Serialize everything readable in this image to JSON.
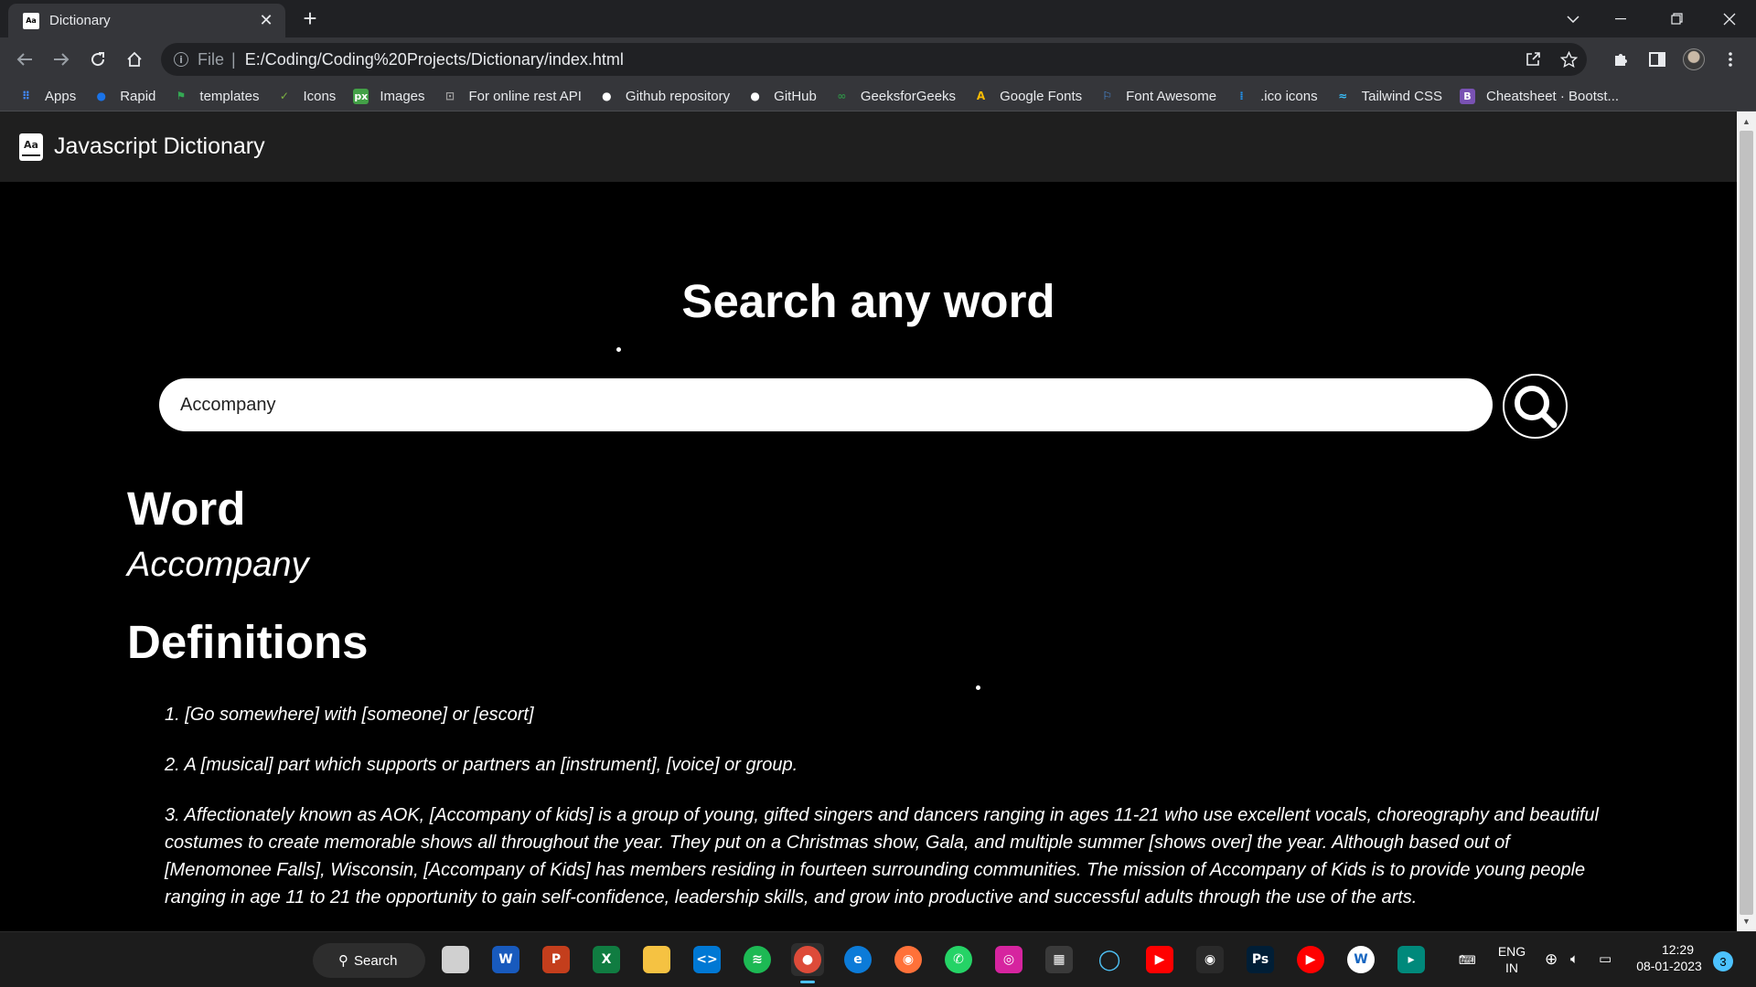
{
  "browser": {
    "tab_title": "Dictionary",
    "tab_favicon_text": "Aa",
    "url_scheme_label": "File",
    "url": "E:/Coding/Coding%20Projects/Dictionary/index.html"
  },
  "bookmarks": [
    {
      "label": "Apps",
      "icon": "apps-grid-icon",
      "color": "#4285f4"
    },
    {
      "label": "Rapid",
      "icon": "rapid-icon",
      "color": "#1a73e8"
    },
    {
      "label": "templates",
      "icon": "templates-flag-icon",
      "color": "#34a853"
    },
    {
      "label": "Icons",
      "icon": "icons-check-icon",
      "color": "#7cb342"
    },
    {
      "label": "Images",
      "icon": "px-icon",
      "color": "#43a047"
    },
    {
      "label": "For online rest API",
      "icon": "rest-api-icon",
      "color": "#9e9e9e"
    },
    {
      "label": "Github repository",
      "icon": "github-icon",
      "color": "#ffffff"
    },
    {
      "label": "GitHub",
      "icon": "github-icon",
      "color": "#ffffff"
    },
    {
      "label": "GeeksforGeeks",
      "icon": "gfg-icon",
      "color": "#2f8d46"
    },
    {
      "label": "Google Fonts",
      "icon": "google-fonts-icon",
      "color": "#fbbc04"
    },
    {
      "label": "Font Awesome",
      "icon": "font-awesome-flag-icon",
      "color": "#4a90e2"
    },
    {
      "label": ".ico icons",
      "icon": "ico-icons-icon",
      "color": "#2196f3"
    },
    {
      "label": "Tailwind CSS",
      "icon": "tailwind-icon",
      "color": "#38bdf8"
    },
    {
      "label": "Cheatsheet · Bootst...",
      "icon": "bootstrap-icon",
      "color": "#7952b3"
    }
  ],
  "app": {
    "brand_icon_text": "Aa",
    "brand": "Javascript Dictionary",
    "heading": "Search any word",
    "search_value": "Accompany",
    "word_label": "Word",
    "word": "Accompany",
    "definitions_label": "Definitions",
    "definitions": [
      "1. [Go somewhere] with [someone] or [escort]",
      "2. A [musical] part which supports or partners an [instrument], [voice] or group.",
      "3. Affectionately known as AOK, [Accompany of kids] is a group of young, gifted singers and dancers ranging in ages 11-21 who use excellent vocals, choreography and beautiful costumes to create memorable shows all throughout the year. They put on a Christmas show, Gala, and multiple summer [shows over] the year. Although based out of [Menomonee Falls], Wisconsin, [Accompany of Kids] has members residing in fourteen surrounding communities. The mission of Accompany of Kids is to provide young people ranging in age 11 to 21 the opportunity to gain self-confidence, leadership skills, and grow into productive and successful adults through the use of the arts."
    ]
  },
  "taskbar": {
    "search_label": "Search",
    "lang_line1": "ENG",
    "lang_line2": "IN",
    "time": "12:29",
    "date": "08-01-2023",
    "notification_count": "3",
    "apps": [
      {
        "name": "windows-start-icon",
        "color": "#4cc2ff",
        "glyph": ""
      },
      {
        "name": "task-view-icon",
        "color": "#d0d0d0",
        "glyph": ""
      },
      {
        "name": "word-icon",
        "color": "#185abd",
        "glyph": "W"
      },
      {
        "name": "powerpoint-icon",
        "color": "#c43e1c",
        "glyph": "P"
      },
      {
        "name": "excel-icon",
        "color": "#107c41",
        "glyph": "X"
      },
      {
        "name": "file-explorer-icon",
        "color": "#f5c242",
        "glyph": ""
      },
      {
        "name": "vscode-icon",
        "color": "#0078d4",
        "glyph": "<>"
      },
      {
        "name": "spotify-icon",
        "color": "#1db954",
        "glyph": "≋"
      },
      {
        "name": "chrome-icon",
        "color": "#dd4b39",
        "glyph": "●"
      },
      {
        "name": "edge-icon",
        "color": "#0c7bd8",
        "glyph": "e"
      },
      {
        "name": "firefox-icon",
        "color": "#ff7139",
        "glyph": "◉"
      },
      {
        "name": "whatsapp-icon",
        "color": "#25d366",
        "glyph": "✆"
      },
      {
        "name": "instagram-icon",
        "color": "#d6249f",
        "glyph": "◎"
      },
      {
        "name": "microsoft-store-icon",
        "color": "#3a3a3a",
        "glyph": "▦"
      },
      {
        "name": "cortana-icon",
        "color": "#1c1c1c",
        "glyph": "◯"
      },
      {
        "name": "youtube-icon",
        "color": "#ff0000",
        "glyph": "▶"
      },
      {
        "name": "camera-icon",
        "color": "#2a2a2a",
        "glyph": "◉"
      },
      {
        "name": "photoshop-icon",
        "color": "#001e36",
        "glyph": "Ps"
      },
      {
        "name": "youtube-music-icon",
        "color": "#ff0000",
        "glyph": "▶"
      },
      {
        "name": "wordweb-icon",
        "color": "#ffffff",
        "glyph": "W"
      },
      {
        "name": "google-meet-icon",
        "color": "#00897b",
        "glyph": "▸"
      }
    ]
  }
}
